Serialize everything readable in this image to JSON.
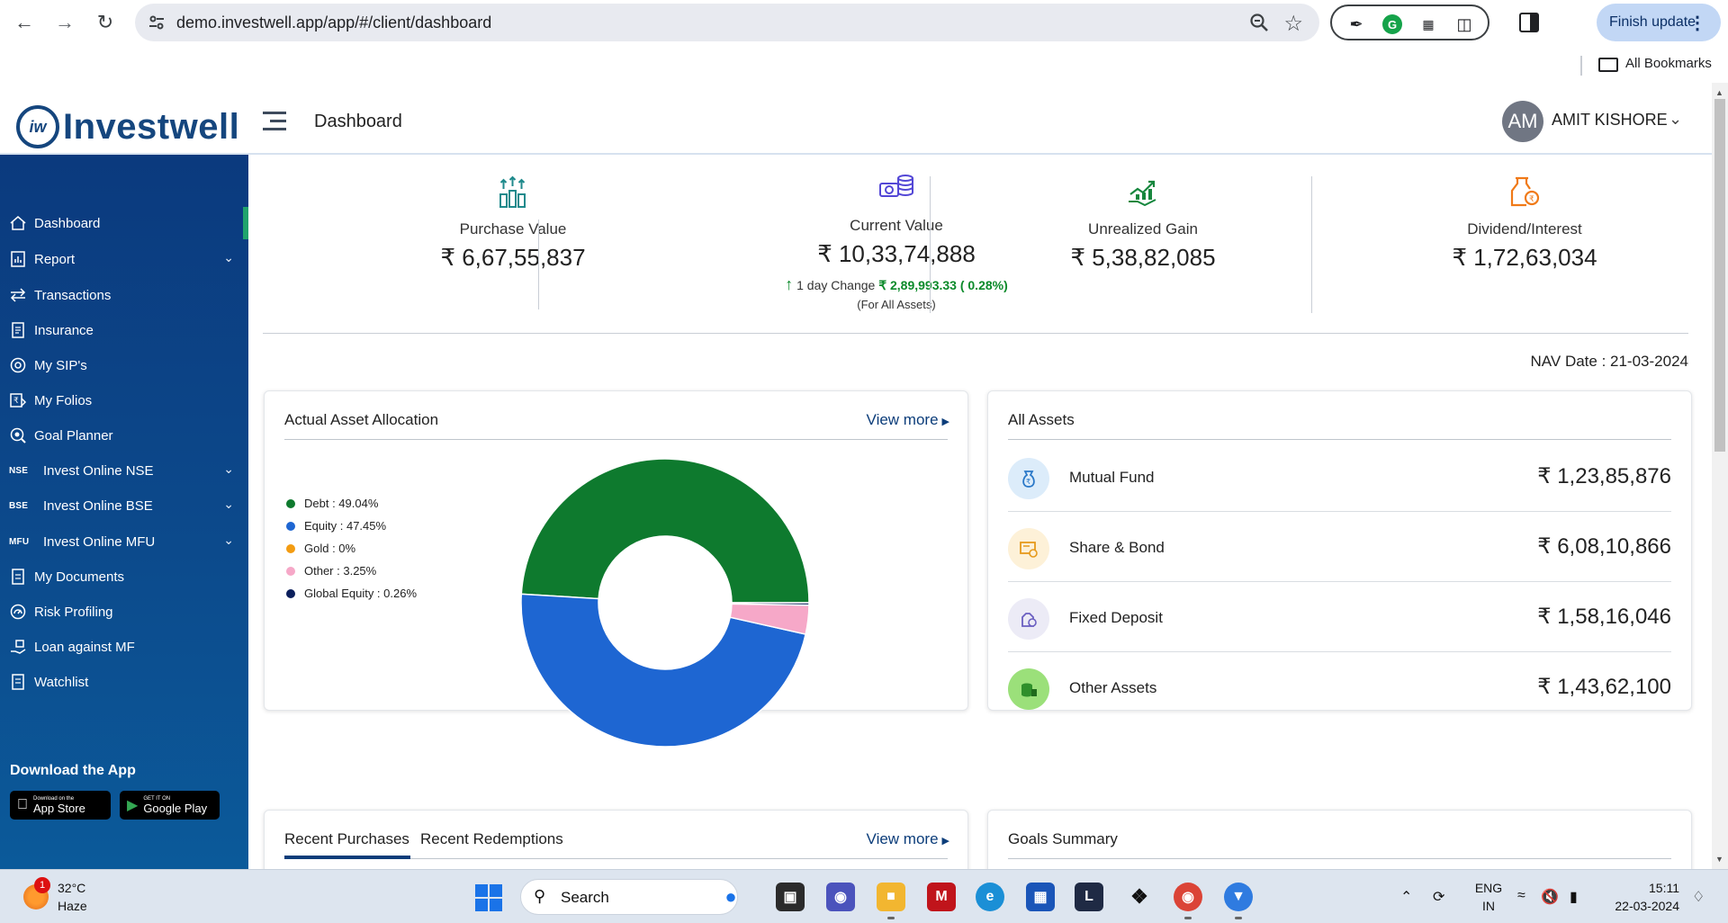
{
  "browser": {
    "url": "demo.investwell.app/app/#/client/dashboard",
    "finish_update": "Finish update",
    "all_bookmarks": "All Bookmarks"
  },
  "header": {
    "logo_text": "Investwell",
    "logo_mark": "iw",
    "page_title": "Dashboard",
    "user_initials": "AM",
    "user_name": "AMIT KISHORE"
  },
  "sidebar": {
    "items": [
      {
        "label": "Dashboard",
        "icon": "home-icon"
      },
      {
        "label": "Report",
        "icon": "report-icon"
      },
      {
        "label": "Transactions",
        "icon": "transfer-icon"
      },
      {
        "label": "Insurance",
        "icon": "document-icon"
      },
      {
        "label": "My SIP's",
        "icon": "sip-icon"
      },
      {
        "label": "My Folios",
        "icon": "folio-icon"
      },
      {
        "label": "Goal Planner",
        "icon": "goal-icon"
      },
      {
        "label": "Invest Online NSE",
        "tag": "NSE"
      },
      {
        "label": "Invest Online BSE",
        "tag": "BSE"
      },
      {
        "label": "Invest Online MFU",
        "tag": "MFU"
      },
      {
        "label": "My Documents",
        "icon": "document-icon"
      },
      {
        "label": "Risk Profiling",
        "icon": "risk-icon"
      },
      {
        "label": "Loan against MF",
        "icon": "loan-icon"
      },
      {
        "label": "Watchlist",
        "icon": "watchlist-icon"
      }
    ],
    "download_title": "Download the App",
    "app_store": {
      "small": "Download on the",
      "big": "App Store"
    },
    "google_play": {
      "small": "GET IT ON",
      "big": "Google Play"
    }
  },
  "summary": {
    "purchase": {
      "label": "Purchase Value",
      "value": "₹  6,67,55,837"
    },
    "current": {
      "label": "Current Value",
      "value": "₹  10,33,74,888",
      "change_label": "1 day Change",
      "change_value": "₹ 2,89,993.33 ( 0.28%)",
      "for_all": "(For All Assets)"
    },
    "unrealized": {
      "label": "Unrealized Gain",
      "value": "₹  5,38,82,085"
    },
    "dividend": {
      "label": "Dividend/Interest",
      "value": "₹  1,72,63,034"
    },
    "nav_date": "NAV Date : 21-03-2024"
  },
  "allocation": {
    "title": "Actual Asset Allocation",
    "view_more": "View more"
  },
  "chart_data": {
    "type": "pie",
    "donut": true,
    "categories": [
      "Debt",
      "Equity",
      "Gold",
      "Other",
      "Global Equity"
    ],
    "values": [
      49.04,
      47.45,
      0,
      3.25,
      0.26
    ],
    "legend": [
      "Debt : 49.04%",
      "Equity : 47.45%",
      "Gold : 0%",
      "Other : 3.25%",
      "Global Equity : 0.26%"
    ],
    "colors": [
      "#0e7a2e",
      "#1e66d2",
      "#f39c12",
      "#f6a8c8",
      "#0b1f5c"
    ],
    "legend_position": "left"
  },
  "assets": {
    "title": "All Assets",
    "items": [
      {
        "name": "Mutual Fund",
        "value": "₹ 1,23,85,876"
      },
      {
        "name": "Share & Bond",
        "value": "₹ 6,08,10,866"
      },
      {
        "name": "Fixed Deposit",
        "value": "₹ 1,58,16,046"
      },
      {
        "name": "Other Assets",
        "value": "₹ 1,43,62,100"
      }
    ]
  },
  "recent": {
    "tab_purchases": "Recent Purchases",
    "tab_redemptions": "Recent Redemptions",
    "view_more": "View more"
  },
  "goals": {
    "title": "Goals Summary"
  },
  "taskbar": {
    "temp": "32°C",
    "condition": "Haze",
    "weather_badge": "1",
    "search": "Search",
    "lang_top": "ENG",
    "lang_bottom": "IN",
    "time": "15:11",
    "date": "22-03-2024"
  }
}
